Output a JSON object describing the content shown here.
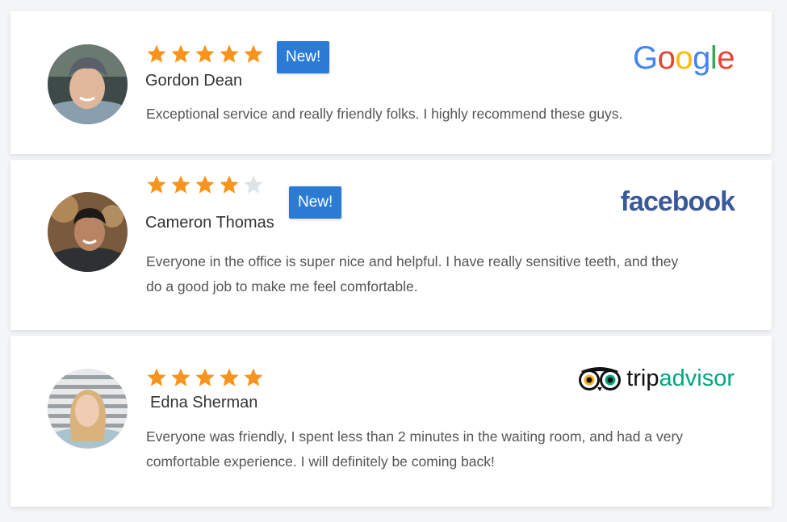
{
  "reviews": [
    {
      "name": "Gordon Dean",
      "rating": 5,
      "max_rating": 5,
      "badge": "New!",
      "source": "Google",
      "source_icon": "google-logo",
      "text": "Exceptional service and really friendly folks. I highly recommend these guys."
    },
    {
      "name": "Cameron Thomas",
      "rating": 4,
      "max_rating": 5,
      "badge": "New!",
      "source": "facebook",
      "source_icon": "facebook-logo",
      "text": "Everyone in the office is super nice and helpful. I have really sensitive teeth, and they do a good job to make me feel comfortable."
    },
    {
      "name": "Edna Sherman",
      "rating": 5,
      "max_rating": 5,
      "badge": "",
      "source": "tripadvisor",
      "source_icon": "tripadvisor-logo",
      "text": "Everyone was friendly, I spent less than 2 minutes in the waiting room, and had a very comfortable experience. I will definitely be coming back!"
    }
  ],
  "brand_words": {
    "google": [
      "G",
      "o",
      "o",
      "g",
      "l",
      "e"
    ],
    "facebook": "facebook",
    "tripadvisor_trip": "trip",
    "tripadvisor_advisor": "advisor"
  },
  "colors": {
    "star_filled": "#f7941d",
    "star_empty": "#dde3e6",
    "badge": "#2b7bd5",
    "facebook": "#3b5998",
    "tripadvisor_green": "#00a680",
    "google": [
      "#4285f4",
      "#ea4335",
      "#fbbc05",
      "#4285f4",
      "#34a853",
      "#ea4335"
    ]
  }
}
